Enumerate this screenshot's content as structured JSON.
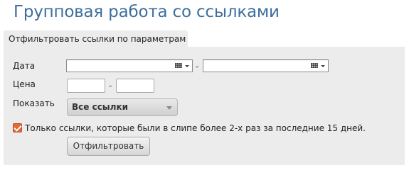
{
  "page": {
    "title": "Групповая работа со ссылками"
  },
  "filter": {
    "tab_label": "Отфильтровать ссылки по параметрам",
    "date_label": "Дата",
    "date_from": "",
    "date_to": "",
    "price_label": "Цена",
    "price_from": "",
    "price_to": "",
    "range_separator": "-",
    "show_label": "Показать",
    "show_selected": "Все ссылки",
    "only_repeated_checked": true,
    "only_repeated_label": "Только ссылки, которые были в слипе более 2-х раз за последние 15 дней.",
    "submit_label": "Отфильтровать"
  },
  "icons": {
    "calendar": "calendar-icon",
    "dropdown": "chevron-down-icon",
    "check": "checkmark-icon"
  },
  "colors": {
    "title": "#3e6f9c",
    "panel": "#ececec",
    "checkbox": "#e06a3a"
  }
}
